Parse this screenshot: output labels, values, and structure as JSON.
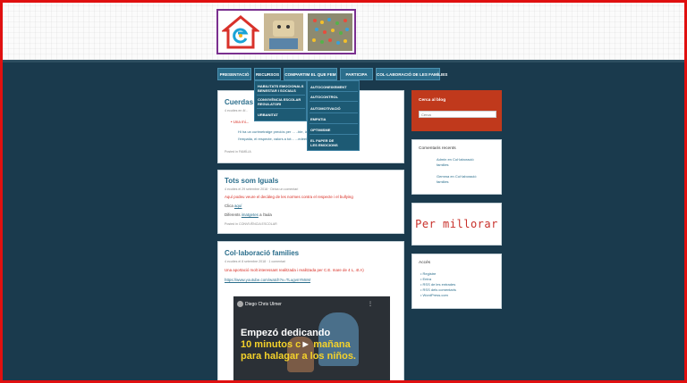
{
  "nav": {
    "items": [
      "PRESENTACIÓ",
      "RECURSOS",
      "COMPARTIM EL QUE FEM",
      "PARTICIPA",
      "COL·LABORACIÓ DE LES FAMÍLIES"
    ]
  },
  "dropdown": {
    "left": [
      "HABILITATS EMOCIONALS",
      "BENESTAR I SOCIALS",
      "CONVIVÈNCIA ESCOLAR",
      "REGULATORI",
      "URBANITAT"
    ],
    "right": [
      "AUTOCONEIXEMENT",
      "AUTOCONTROL",
      "AUTOMOTIVACIÓ",
      "EMPATIA",
      "OPTIMISME",
      "EL PAPER DE",
      "LES EMOCIONS"
    ]
  },
  "post1": {
    "title": "Cuerdas",
    "meta": "4 ecuties en 4f...",
    "bullet": "• Una mi...",
    "line2": "Hi ha un curtmetratge preciós per ...                                        ..ble, la solidaritat,",
    "line3": "l'empatia, el respecte, valors a tot...                                   ...edeeltan.com",
    "footer": "Posted in FAMÍLIA"
  },
  "post2": {
    "title": "Tots som Iguals",
    "meta": "4 ecuties el 29 setembre 2018 · Deixa un comentari",
    "line1": "Aquí podeu veure el decàleg de les normes contra el respecte i el bullying",
    "line2_prefix": "Clica ",
    "line2_link": "aquí",
    "line3_prefix": "Diferents ",
    "line3_link": "imatgetes",
    "line3_suffix": " a l'aula",
    "footer": "Posted in CONVIVÈNCIA ESCOLAR"
  },
  "post3": {
    "title": "Col·laboració families",
    "meta": "4 ecuties el 8 setembre 2018 · 1 comentari",
    "line1": "Una aportació molt interessant realitzada i realitzada per C.E. mare de 4 L, 4t A)",
    "link": "https://www.youtube.com/watch?v=TLugvnYMnM",
    "video_channel": "Diego Chris Ulmer",
    "video_line1": "Empezó dedicando",
    "video_line2": "10 minutos c",
    "video_line2b": " mañana",
    "video_line3": "para halagar a los niños."
  },
  "sidebar": {
    "search_title": "Cerca al blog",
    "search_placeholder": "Cerca",
    "comments_title": "Comentaris recents",
    "comment1_a": "Admin en Col·laboració",
    "comment1_b": "families",
    "comment2_a": "Gemma en Col·laboració",
    "comment2_b": "families",
    "banner": "Per millorar",
    "access_title": "Accés",
    "access_items": [
      "Registre",
      "Entra",
      "RSS de les entrades",
      "RSS dels comentaris",
      "WordPress.com"
    ]
  },
  "colors": {
    "frame": "#e01010",
    "background": "#1a3a4d",
    "nav": "#2b6e8c",
    "accent_red": "#d82a20",
    "search_widget": "#c0391c"
  }
}
